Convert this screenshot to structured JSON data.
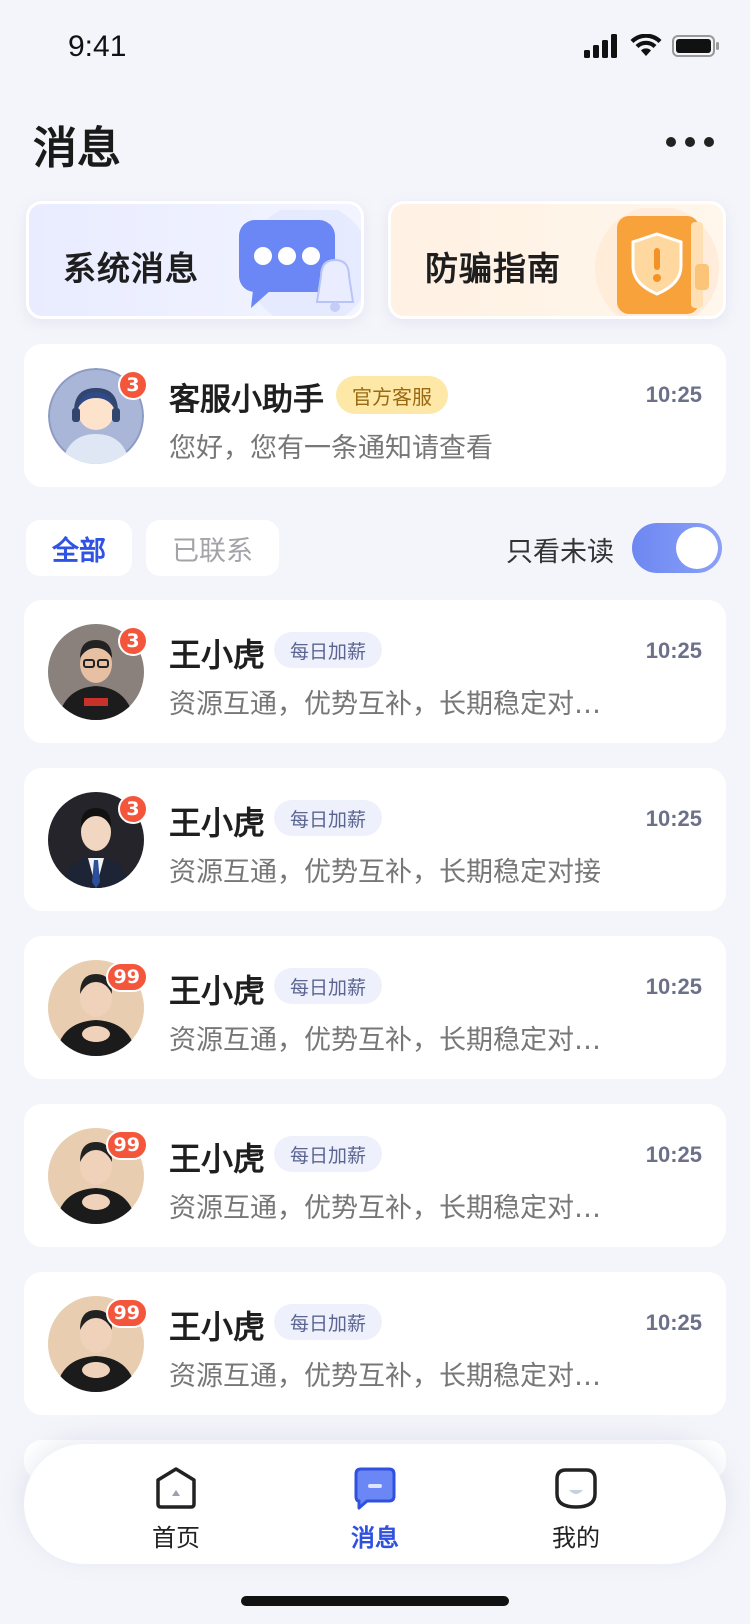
{
  "status_bar": {
    "time": "9:41"
  },
  "header": {
    "title": "消息"
  },
  "quick_cards": [
    {
      "label": "系统消息",
      "icon": "chat-bubble-bell-icon"
    },
    {
      "label": "防骗指南",
      "icon": "shield-book-icon"
    }
  ],
  "service": {
    "name": "客服小助手",
    "tag": "官方客服",
    "time": "10:25",
    "message": "您好，您有一条通知请查看",
    "badge": "3"
  },
  "filters": {
    "tabs": [
      "全部",
      "已联系"
    ],
    "active": "全部",
    "only_unread_label": "只看未读",
    "only_unread": true
  },
  "chats": [
    {
      "name": "王小虎",
      "tag": "每日加薪",
      "time": "10:25",
      "message": "资源互通，优势互补，长期稳定对…",
      "badge": "3"
    },
    {
      "name": "王小虎",
      "tag": "每日加薪",
      "time": "10:25",
      "message": "资源互通，优势互补，长期稳定对接",
      "badge": "3"
    },
    {
      "name": "王小虎",
      "tag": "每日加薪",
      "time": "10:25",
      "message": "资源互通，优势互补，长期稳定对…",
      "badge": "99"
    },
    {
      "name": "王小虎",
      "tag": "每日加薪",
      "time": "10:25",
      "message": "资源互通，优势互补，长期稳定对…",
      "badge": "99"
    },
    {
      "name": "王小虎",
      "tag": "每日加薪",
      "time": "10:25",
      "message": "资源互通，优势互补，长期稳定对…",
      "badge": "99"
    }
  ],
  "bottom_nav": [
    {
      "label": "首页",
      "icon": "home-icon"
    },
    {
      "label": "消息",
      "icon": "message-icon",
      "active": true
    },
    {
      "label": "我的",
      "icon": "profile-icon"
    }
  ],
  "colors": {
    "accent": "#3153e4",
    "badge": "#f4563c",
    "background": "#f4f5fa"
  }
}
